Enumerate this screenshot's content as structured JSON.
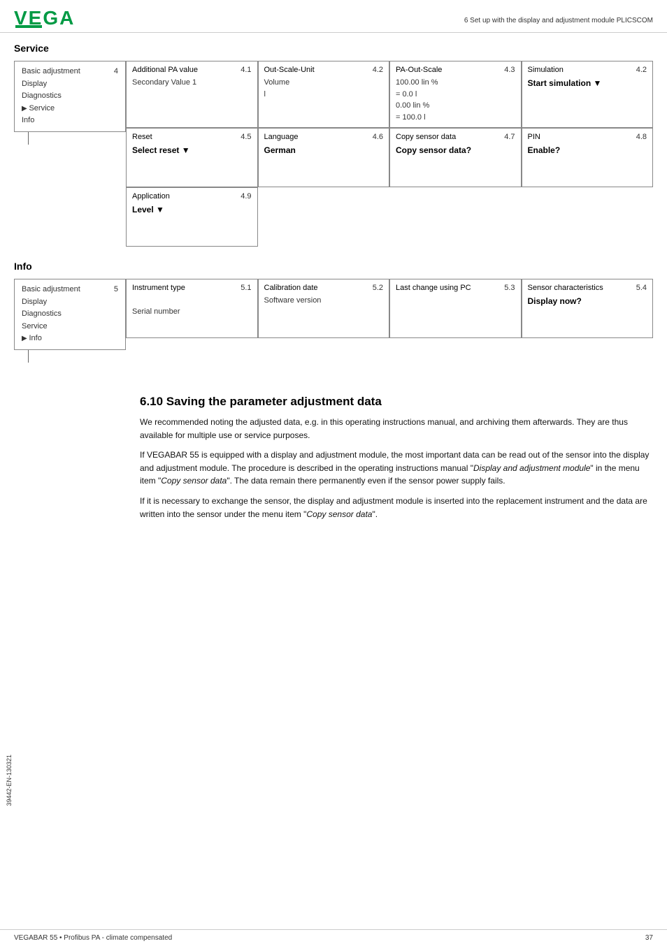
{
  "header": {
    "logo": "VEGA",
    "chapter": "6 Set up with the display and adjustment module PLICSCOM"
  },
  "service_section": {
    "title": "Service",
    "menu": {
      "items": [
        {
          "label": "Basic adjustment",
          "number": "4",
          "selected": false
        },
        {
          "label": "Display",
          "selected": false
        },
        {
          "label": "Diagnostics",
          "selected": false
        },
        {
          "label": "Service",
          "selected": true
        },
        {
          "label": "Info",
          "selected": false
        }
      ]
    },
    "row1": [
      {
        "title": "Additional PA value",
        "number": "4.1",
        "lines": [
          "Secondary Value 1"
        ]
      },
      {
        "title": "Out-Scale-Unit",
        "number": "4.2",
        "lines": [
          "Volume",
          "l"
        ]
      },
      {
        "title": "PA-Out-Scale",
        "number": "4.3",
        "lines": [
          "100.00 lin %",
          "= 0.0 l",
          "0.00 lin %",
          "= 100.0 l"
        ]
      },
      {
        "title": "Simulation",
        "number": "4.2",
        "action": "Start simulation ▼"
      }
    ],
    "row2": [
      {
        "title": "Reset",
        "number": "4.5",
        "action": "Select reset ▼"
      },
      {
        "title": "Language",
        "number": "4.6",
        "action": "German"
      },
      {
        "title": "Copy sensor data",
        "number": "4.7",
        "action": "Copy sensor data?"
      },
      {
        "title": "PIN",
        "number": "4.8",
        "action": "Enable?"
      }
    ],
    "row3": [
      {
        "title": "Application",
        "number": "4.9",
        "action": "Level ▼"
      }
    ]
  },
  "info_section": {
    "title": "Info",
    "menu": {
      "items": [
        {
          "label": "Basic adjustment",
          "number": "5",
          "selected": false
        },
        {
          "label": "Display",
          "selected": false
        },
        {
          "label": "Diagnostics",
          "selected": false
        },
        {
          "label": "Service",
          "selected": false
        },
        {
          "label": "Info",
          "selected": true
        }
      ]
    },
    "row1": [
      {
        "title": "Instrument type",
        "number": "5.1",
        "lines": [
          "",
          "Serial number"
        ]
      },
      {
        "title": "Calibration date",
        "number": "5.2",
        "lines": [
          "Software version"
        ]
      },
      {
        "title": "Last change using PC",
        "number": "5.3",
        "lines": []
      },
      {
        "title": "Sensor characteristics",
        "number": "5.4",
        "action": "Display now?"
      }
    ]
  },
  "text_section": {
    "heading": "6.10  Saving the parameter adjustment data",
    "paragraphs": [
      "We recommended noting the adjusted data, e.g. in this operating instructions manual, and archiving them afterwards. They are thus available for multiple use or service purposes.",
      "If VEGABAR 55 is equipped with a display and adjustment module, the most important data can be read out of the sensor into the display and adjustment module. The procedure is described in the operating instructions manual \"Display and adjustment module\" in the menu item \"Copy sensor data\". The data remain there permanently even if the sensor power supply fails.",
      "If it is necessary to exchange the sensor, the display and adjustment module is inserted into the replacement instrument and the data are written into the sensor under the menu item \"Copy sensor data\"."
    ],
    "italic_parts": {
      "p2_italic1": "Display and adjustment module",
      "p2_italic2": "Copy sensor data",
      "p3_italic1": "Copy sensor data"
    }
  },
  "footer": {
    "left": "VEGABAR 55 • Profibus PA - climate compensated",
    "right": "37"
  },
  "side_label": "39442-EN-130321"
}
